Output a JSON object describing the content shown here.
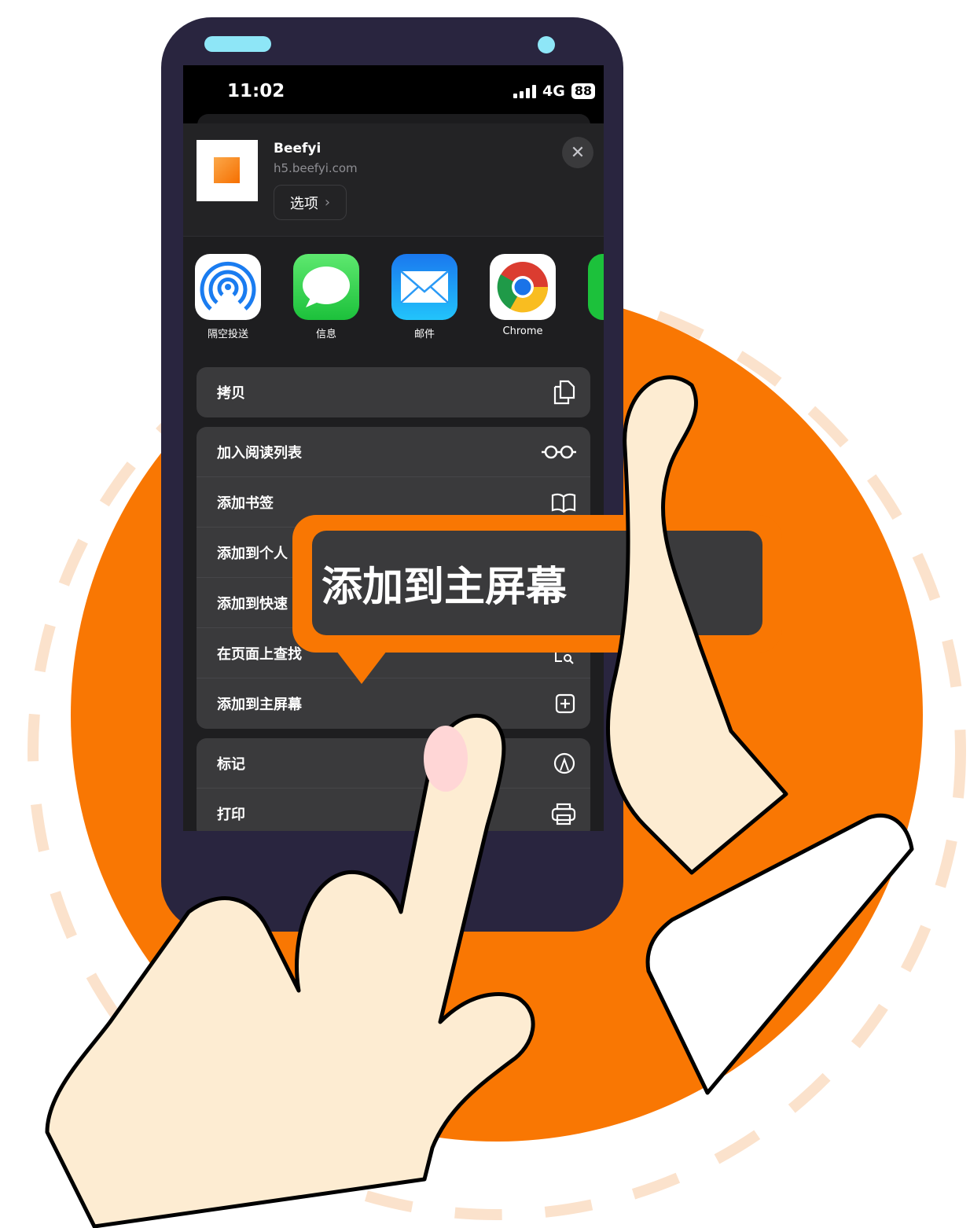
{
  "status_bar": {
    "time": "11:02",
    "network": "4G",
    "battery": "88"
  },
  "share_sheet": {
    "site_title": "Beefyi",
    "site_url": "h5.beefyi.com",
    "options_label": "选项",
    "close_icon": "close-icon",
    "apps": [
      {
        "label": "隔空投送",
        "icon": "airdrop-icon"
      },
      {
        "label": "信息",
        "icon": "messages-icon"
      },
      {
        "label": "邮件",
        "icon": "mail-icon"
      },
      {
        "label": "Chrome",
        "icon": "chrome-icon"
      }
    ],
    "group1": [
      {
        "label": "拷贝",
        "icon": "copy-icon"
      }
    ],
    "group2": [
      {
        "label": "加入阅读列表",
        "icon": "glasses-icon"
      },
      {
        "label": "添加书签",
        "icon": "book-icon"
      },
      {
        "label": "添加到个人",
        "icon": ""
      },
      {
        "label": "添加到快速",
        "icon": ""
      },
      {
        "label": "在页面上查找",
        "icon": "find-icon"
      },
      {
        "label": "添加到主屏幕",
        "icon": "plus-square-icon"
      }
    ],
    "group3": [
      {
        "label": "标记",
        "icon": "markup-icon"
      },
      {
        "label": "打印",
        "icon": "print-icon"
      }
    ]
  },
  "callout": {
    "text": "添加到主屏幕"
  },
  "colors": {
    "accent": "#f97703",
    "phone": "#29253f",
    "skin": "#fdecd2"
  }
}
